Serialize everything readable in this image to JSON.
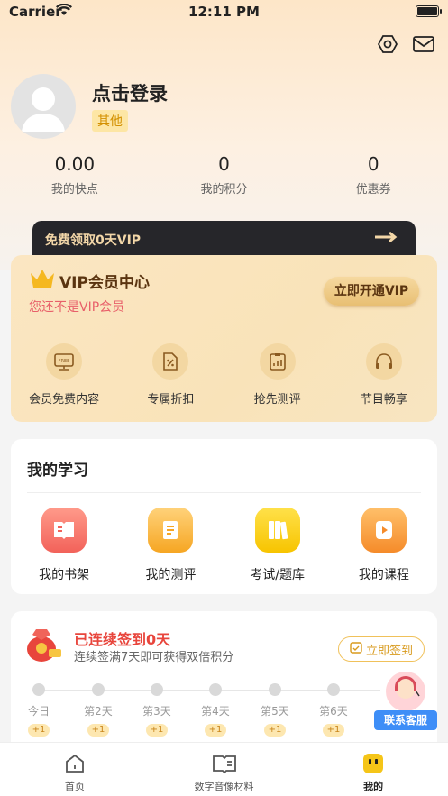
{
  "status": {
    "carrier": "Carrier",
    "time": "12:11 PM"
  },
  "header": {
    "settings_icon": "settings-hex-icon",
    "mail_icon": "mail-icon"
  },
  "profile": {
    "login_text": "点击登录",
    "tag": "其他"
  },
  "stats": [
    {
      "value": "0.00",
      "label": "我的快点"
    },
    {
      "value": "0",
      "label": "我的积分"
    },
    {
      "value": "0",
      "label": "优惠券"
    }
  ],
  "vip_banner": {
    "text": "免费领取0天VIP"
  },
  "vip_card": {
    "title": "VIP会员中心",
    "subtitle": "您还不是VIP会员",
    "button": "立即开通VIP",
    "features": [
      "会员免费内容",
      "专属折扣",
      "抢先测评",
      "节目畅享"
    ]
  },
  "study": {
    "title": "我的学习",
    "items": [
      "我的书架",
      "我的测评",
      "考试/题库",
      "我的课程"
    ]
  },
  "signin": {
    "title": "已连续签到0天",
    "subtitle": "连续签满7天即可获得双倍积分",
    "button": "立即签到",
    "days": [
      {
        "label": "今日",
        "bonus": "+1"
      },
      {
        "label": "第2天",
        "bonus": "+1"
      },
      {
        "label": "第3天",
        "bonus": "+1"
      },
      {
        "label": "第4天",
        "bonus": "+1"
      },
      {
        "label": "第5天",
        "bonus": "+1"
      },
      {
        "label": "第6天",
        "bonus": "+1"
      }
    ]
  },
  "customer_service": {
    "label": "联系客服"
  },
  "tabs": [
    {
      "label": "首页"
    },
    {
      "label": "数字音像材料"
    },
    {
      "label": "我的"
    }
  ],
  "colors": {
    "accent": "#f5b820",
    "vip_gold": "#e8bf73",
    "signin_red": "#e8453c",
    "cs_blue": "#3e8ef7"
  }
}
